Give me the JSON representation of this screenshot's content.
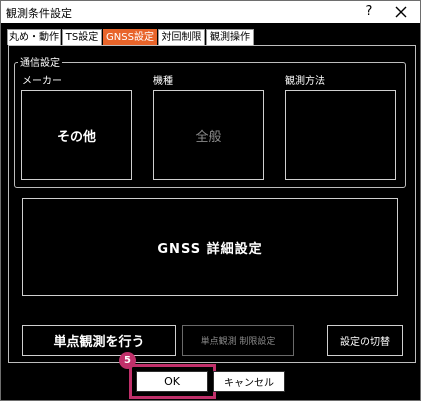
{
  "window": {
    "title": "観測条件設定",
    "help_label": "?",
    "close_icon": "close-icon"
  },
  "tabs": [
    {
      "label": "丸め・動作",
      "active": false
    },
    {
      "label": "TS設定",
      "active": false
    },
    {
      "label": "GNSS設定",
      "active": true
    },
    {
      "label": "対回制限",
      "active": false
    },
    {
      "label": "観測操作",
      "active": false
    }
  ],
  "comm_group": {
    "legend": "通信設定",
    "maker_label": "メーカー",
    "maker_value": "その他",
    "model_label": "機種",
    "model_value": "全般",
    "method_label": "観測方法",
    "method_value": ""
  },
  "gnss_detail_label": "GNSS 詳細設定",
  "buttons": {
    "single_point_label": "単点観測を行う",
    "single_point_limit_label": "単点観測 制限設定",
    "switch_label": "設定の切替",
    "ok_label": "OK",
    "cancel_label": "キャンセル"
  },
  "step_badge": "5",
  "colors": {
    "active_tab": "#e8642a",
    "highlight": "#c0306a",
    "background": "#000000"
  }
}
